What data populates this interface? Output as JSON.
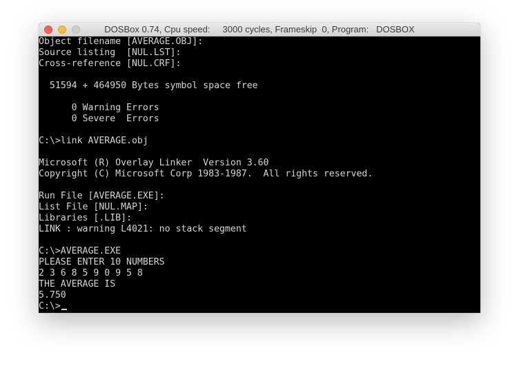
{
  "window": {
    "title": "DOSBox 0.74, Cpu speed:     3000 cycles, Frameskip  0, Program:   DOSBOX"
  },
  "console": {
    "lines": [
      "Object filename [AVERAGE.OBJ]:",
      "Source listing  [NUL.LST]:",
      "Cross-reference [NUL.CRF]:",
      "",
      "  51594 + 464950 Bytes symbol space free",
      "",
      "      0 Warning Errors",
      "      0 Severe  Errors",
      "",
      "C:\\>link AVERAGE.obj",
      "",
      "Microsoft (R) Overlay Linker  Version 3.60",
      "Copyright (C) Microsoft Corp 1983-1987.  All rights reserved.",
      "",
      "Run File [AVERAGE.EXE]:",
      "List File [NUL.MAP]:",
      "Libraries [.LIB]:",
      "LINK : warning L4021: no stack segment",
      "",
      "C:\\>AVERAGE.EXE",
      "PLEASE ENTER 10 NUMBERS",
      "2 3 6 8 5 9 0 9 5 8",
      "THE AVERAGE IS",
      "5.750",
      "C:\\>"
    ]
  }
}
